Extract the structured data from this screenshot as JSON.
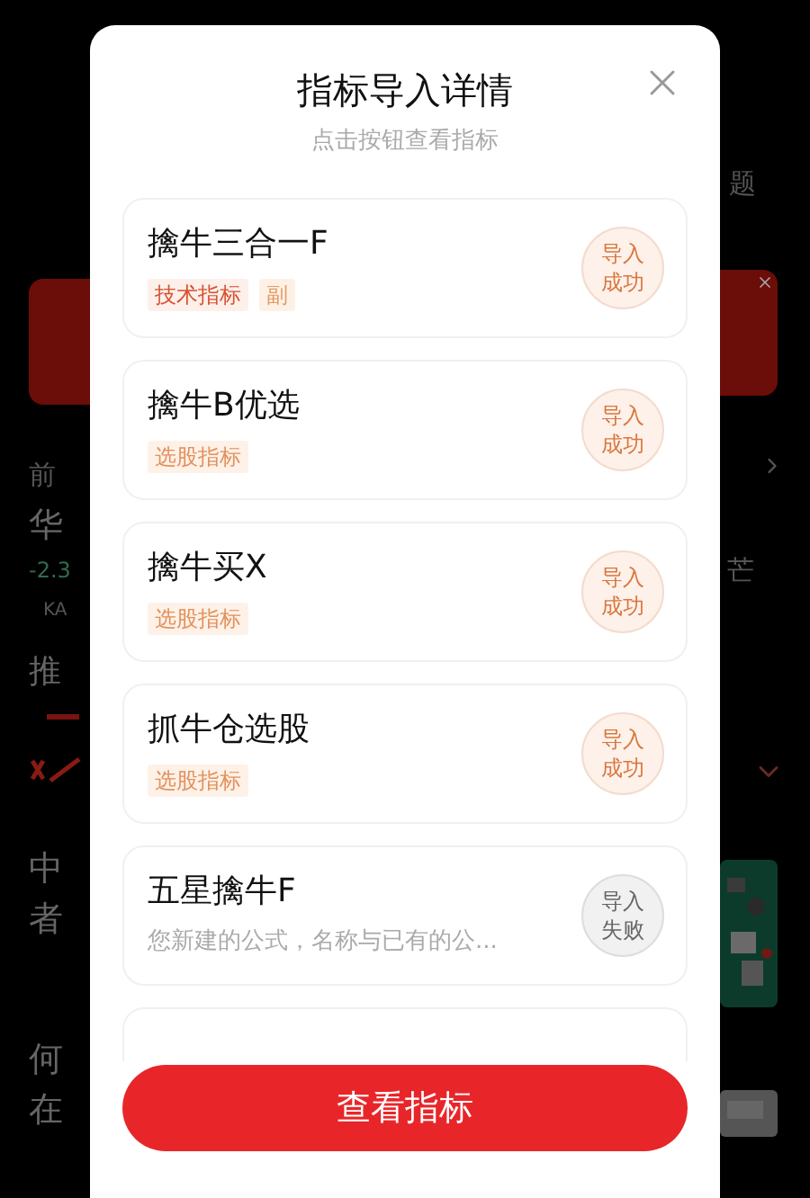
{
  "background": {
    "left_texts": [
      {
        "text": "前",
        "kind": "small"
      },
      {
        "text": "华",
        "kind": "big"
      },
      {
        "text": "-2.3",
        "kind": "change"
      },
      {
        "text": "KA",
        "kind": "tiny"
      },
      {
        "text": "推",
        "kind": "tab"
      },
      {
        "text": "中",
        "kind": "big"
      },
      {
        "text": "者",
        "kind": "big"
      },
      {
        "text": "何",
        "kind": "big"
      },
      {
        "text": "在",
        "kind": "big"
      }
    ],
    "right_texts": [
      {
        "text": "题",
        "kind": "small"
      },
      {
        "text": "芒",
        "kind": "small"
      }
    ]
  },
  "dialog": {
    "title": "指标导入详情",
    "subtitle": "点击按钮查看指标",
    "items": [
      {
        "name": "擒牛三合一F",
        "tags": [
          {
            "label": "技术指标",
            "kind": "tech"
          },
          {
            "label": "副",
            "kind": "sub"
          }
        ],
        "status": {
          "label": "导入成功",
          "kind": "success"
        }
      },
      {
        "name": "擒牛B优选",
        "tags": [
          {
            "label": "选股指标",
            "kind": "pick"
          }
        ],
        "status": {
          "label": "导入成功",
          "kind": "success"
        }
      },
      {
        "name": "擒牛买X",
        "tags": [
          {
            "label": "选股指标",
            "kind": "pick"
          }
        ],
        "status": {
          "label": "导入成功",
          "kind": "success"
        }
      },
      {
        "name": "抓牛仓选股",
        "tags": [
          {
            "label": "选股指标",
            "kind": "pick"
          }
        ],
        "status": {
          "label": "导入成功",
          "kind": "success"
        }
      },
      {
        "name": "五星擒牛F",
        "message": "您新建的公式，名称与已有的公...",
        "status": {
          "label": "导入失败",
          "kind": "fail"
        }
      }
    ],
    "button": "查看指标"
  }
}
